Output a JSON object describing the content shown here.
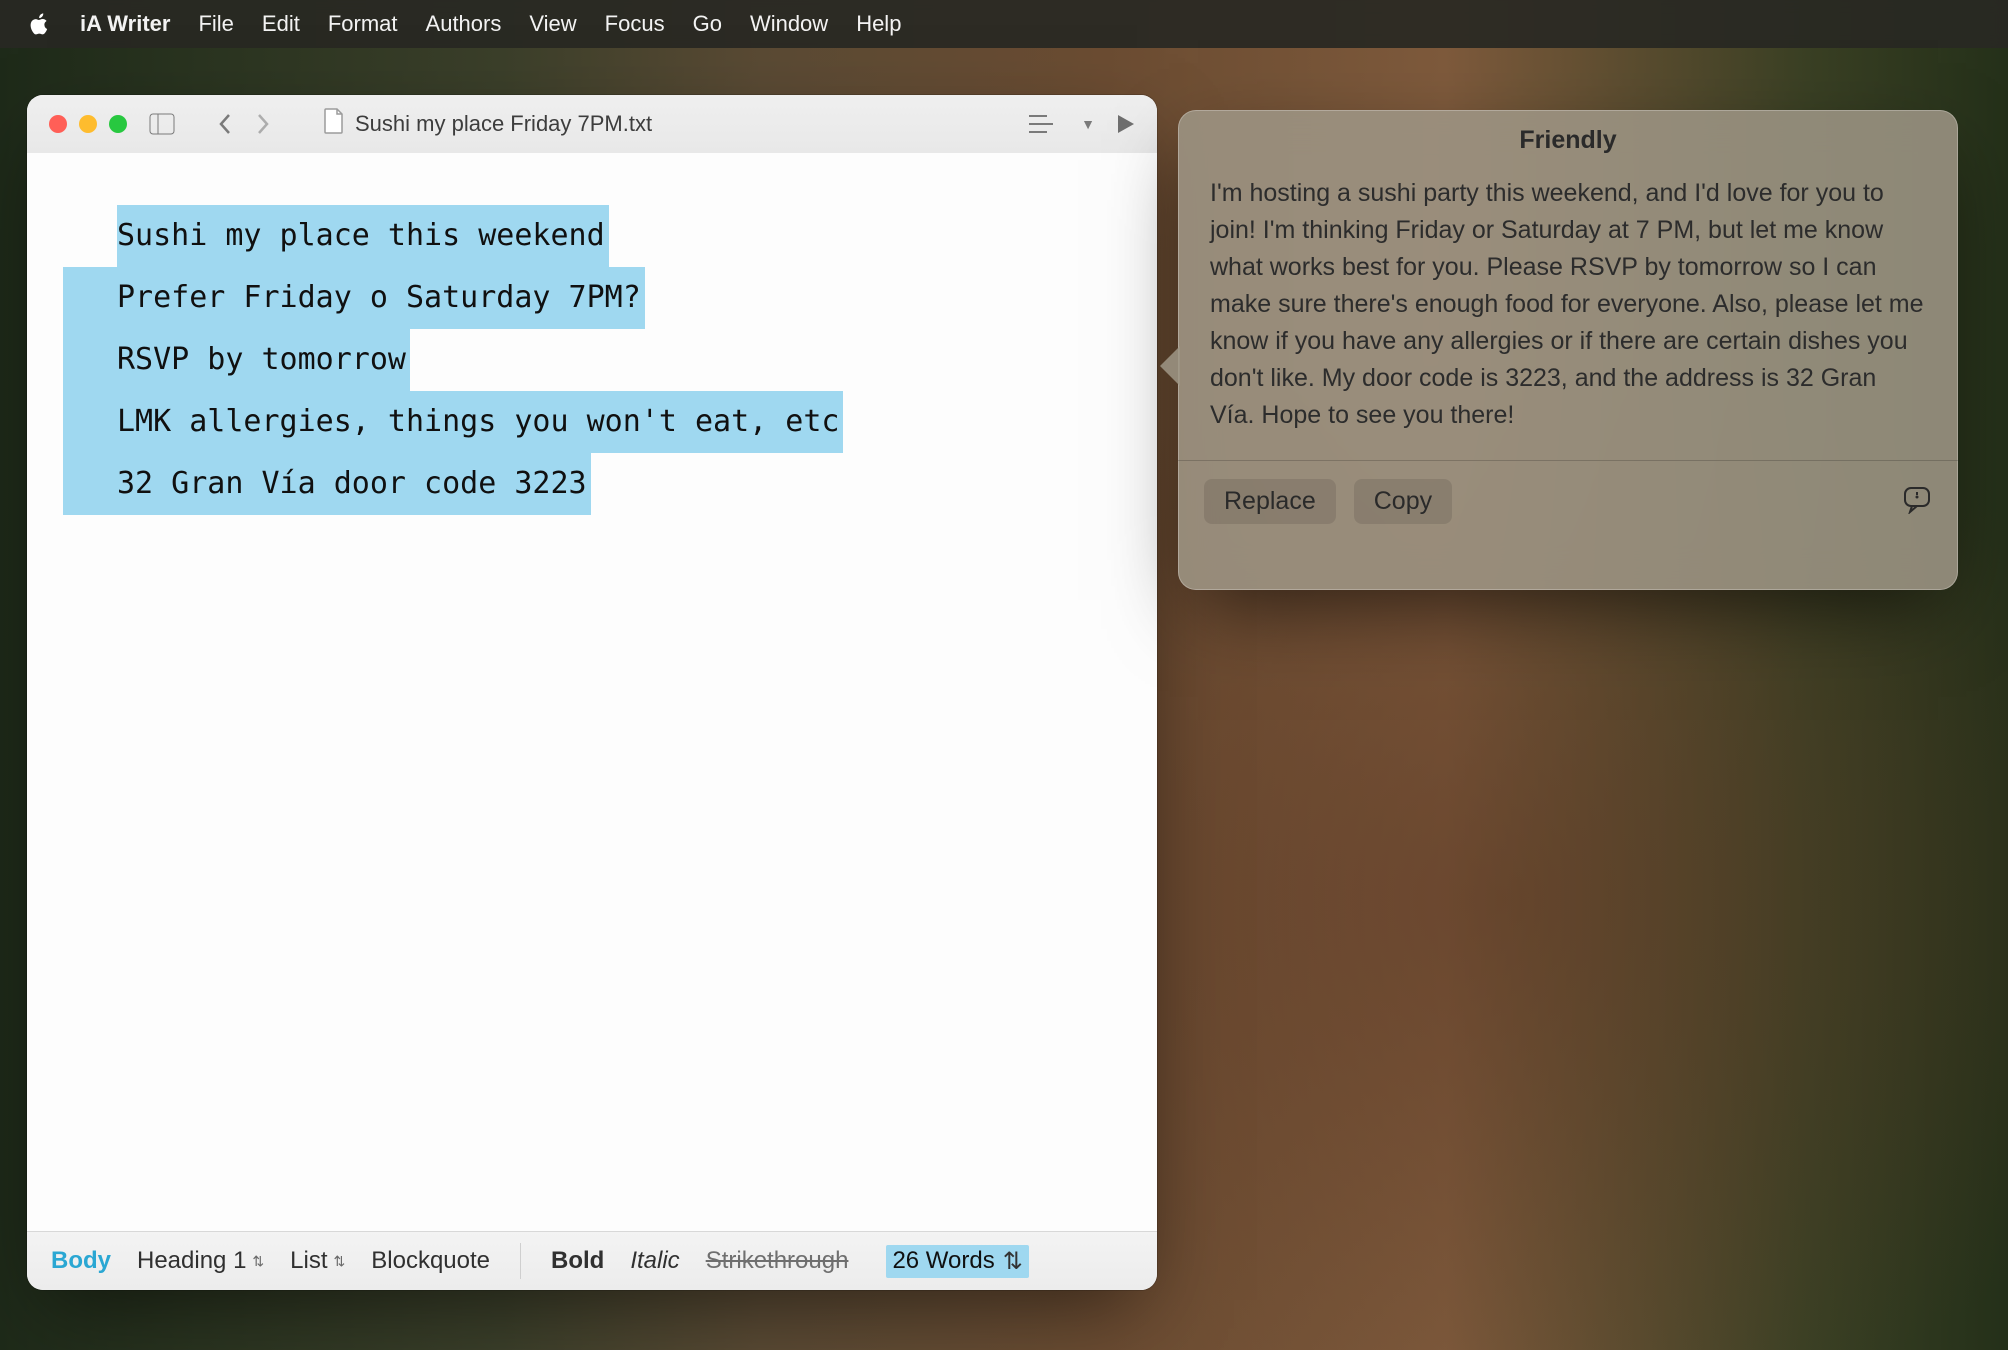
{
  "menubar": {
    "app": "iA Writer",
    "items": [
      "File",
      "Edit",
      "Format",
      "Authors",
      "View",
      "Focus",
      "Go",
      "Window",
      "Help"
    ]
  },
  "window": {
    "filename": "Sushi my place Friday 7PM.txt"
  },
  "document": {
    "lines": [
      "Sushi my place this weekend",
      "Prefer Friday o Saturday 7PM?",
      "RSVP by tomorrow",
      "LMK allergies, things you won't eat, etc",
      "32 Gran Vía door code 3223"
    ]
  },
  "statusbar": {
    "body": "Body",
    "heading": "Heading 1",
    "list": "List",
    "blockquote": "Blockquote",
    "bold": "Bold",
    "italic": "Italic",
    "strike": "Strikethrough",
    "wordcount": "26 Words"
  },
  "popover": {
    "title": "Friendly",
    "body": "I'm hosting a sushi party this weekend, and I'd love for you to join! I'm thinking Friday or Saturday at 7 PM, but let me know what works best for you. Please RSVP by tomorrow so I can make sure there's enough food for everyone. Also, please let me know if you have any allergies or if there are certain dishes you don't like. My door code is 3223, and the address is 32 Gran Vía. Hope to see you there!",
    "replace": "Replace",
    "copy": "Copy"
  }
}
